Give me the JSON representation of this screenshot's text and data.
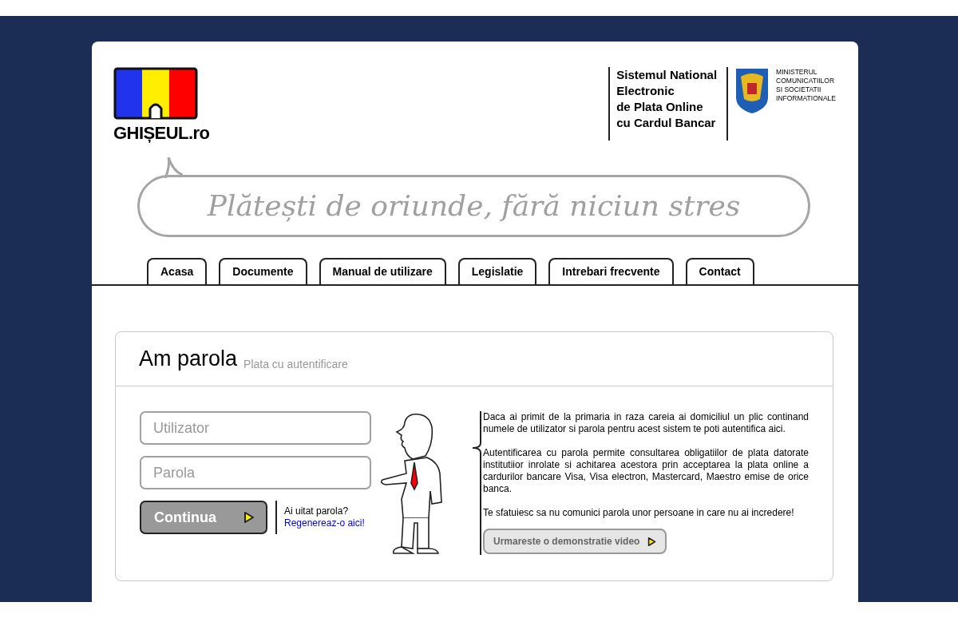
{
  "logo": {
    "text": "GHIȘEUL.ro"
  },
  "system_title": [
    "Sistemul National",
    "Electronic",
    "de Plata Online",
    "cu Cardul Bancar"
  ],
  "ministry": [
    "MINISTERUL",
    "COMUNICATIILOR",
    "SI SOCIETATII",
    "INFORMATIONALE"
  ],
  "slogan": "Plătești de oriunde, fără niciun stres",
  "nav": [
    "Acasa",
    "Documente",
    "Manual de utilizare",
    "Legislatie",
    "Intrebari frecvente",
    "Contact"
  ],
  "login": {
    "title": "Am parola",
    "subtitle": "Plata cu autentificare",
    "username": {
      "placeholder": "Utilizator"
    },
    "password": {
      "placeholder": "Parola"
    },
    "submit": "Continua",
    "forgot_text": "Ai uitat parola?",
    "forgot_link": "Regenereaz-o aici!",
    "paragraphs": [
      "Daca ai primit de la primaria in raza careia ai domiciliul un plic continand numele de utilizator si parola pentru acest sistem te poti autentifica aici.",
      "Autentificarea cu parola permite consultarea obligatiilor de plata datorate institutiior inrolate si achitarea acestora prin acceptarea la plata online a cardurilor bancare Visa, Visa electron, Mastercard, Maestro emise de orice banca.",
      "Te sfatuiesc sa nu comunici parola unor persoane in care nu ai incredere!"
    ],
    "video_button": "Urmareste o demonstratie video"
  }
}
